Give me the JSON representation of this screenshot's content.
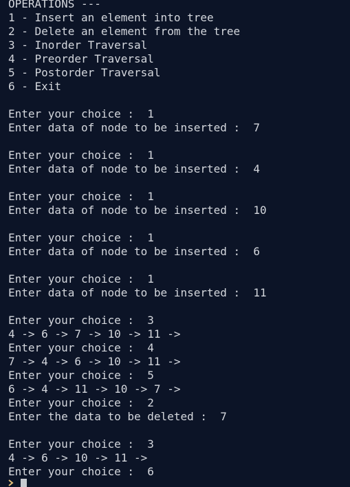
{
  "terminal": {
    "lines": [
      "OPERATIONS ---",
      "1 - Insert an element into tree",
      "2 - Delete an element from the tree",
      "3 - Inorder Traversal",
      "4 - Preorder Traversal",
      "5 - Postorder Traversal",
      "6 - Exit",
      "",
      "Enter your choice :  1",
      "Enter data of node to be inserted :  7",
      "",
      "Enter your choice :  1",
      "Enter data of node to be inserted :  4",
      "",
      "Enter your choice :  1",
      "Enter data of node to be inserted :  10",
      "",
      "Enter your choice :  1",
      "Enter data of node to be inserted :  6",
      "",
      "Enter your choice :  1",
      "Enter data of node to be inserted :  11",
      "",
      "Enter your choice :  3",
      "4 -> 6 -> 7 -> 10 -> 11 ->",
      "Enter your choice :  4",
      "7 -> 4 -> 6 -> 10 -> 11 ->",
      "Enter your choice :  5",
      "6 -> 4 -> 11 -> 10 -> 7 ->",
      "Enter your choice :  2",
      "Enter the data to be deleted :  7",
      "",
      "Enter your choice :  3",
      "4 -> 6 -> 10 -> 11 ->",
      "Enter your choice :  6"
    ]
  },
  "colors": {
    "background": "#0c1427",
    "text": "#d4d7dd",
    "prompt_arrow": "#e5c07b",
    "cursor": "#c8cbd1"
  },
  "icons": {
    "prompt": "prompt-arrow-icon",
    "cursor": "text-cursor"
  }
}
